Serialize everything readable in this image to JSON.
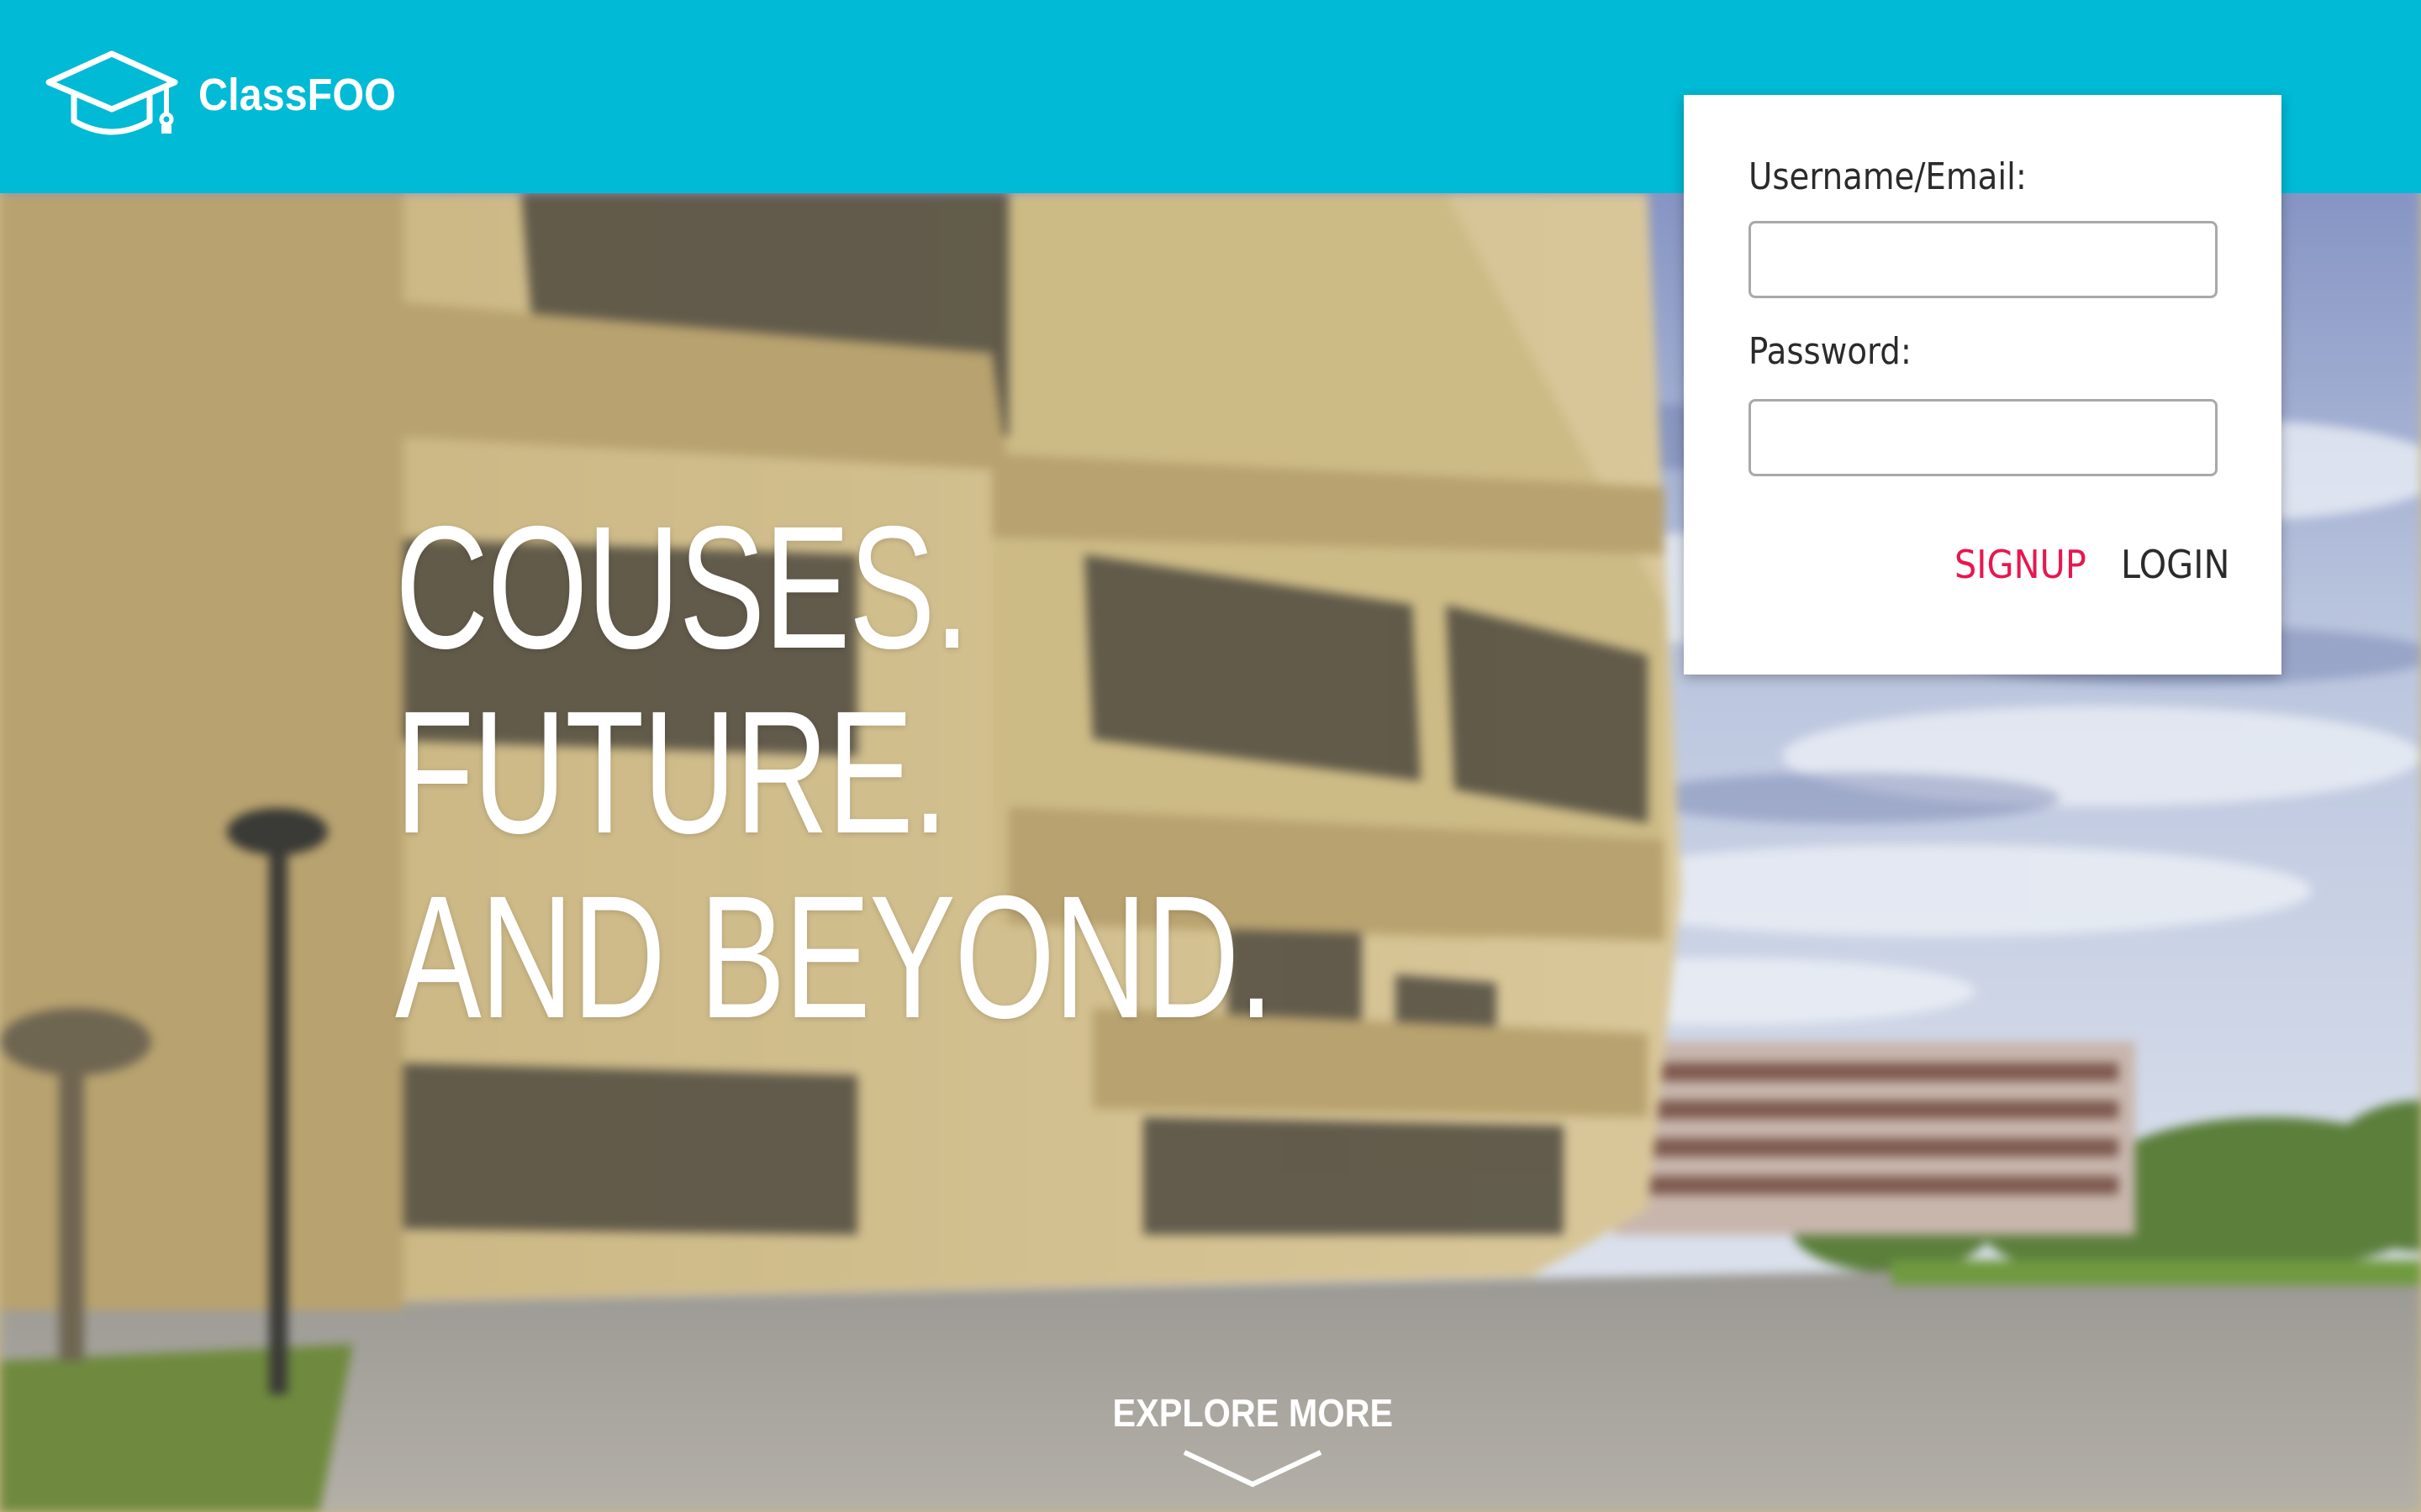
{
  "app": {
    "name": "ClassFOO"
  },
  "colors": {
    "topbar": "#00bad6",
    "signup": "#e8174f",
    "login": "#2b2b2b",
    "headline": "#ffffff"
  },
  "login_form": {
    "username_label": "Username/Email:",
    "username_value": "",
    "password_label": "Password:",
    "password_value": "",
    "signup_label": "SIGNUP",
    "login_label": "LOGIN"
  },
  "hero": {
    "lines": [
      "COUSES.",
      "FUTURE.",
      "AND BEYOND."
    ]
  },
  "explore": {
    "label": "EXPLORE MORE",
    "icon": "chevron-down-icon"
  },
  "icons": {
    "logo": "graduation-cap-icon"
  }
}
